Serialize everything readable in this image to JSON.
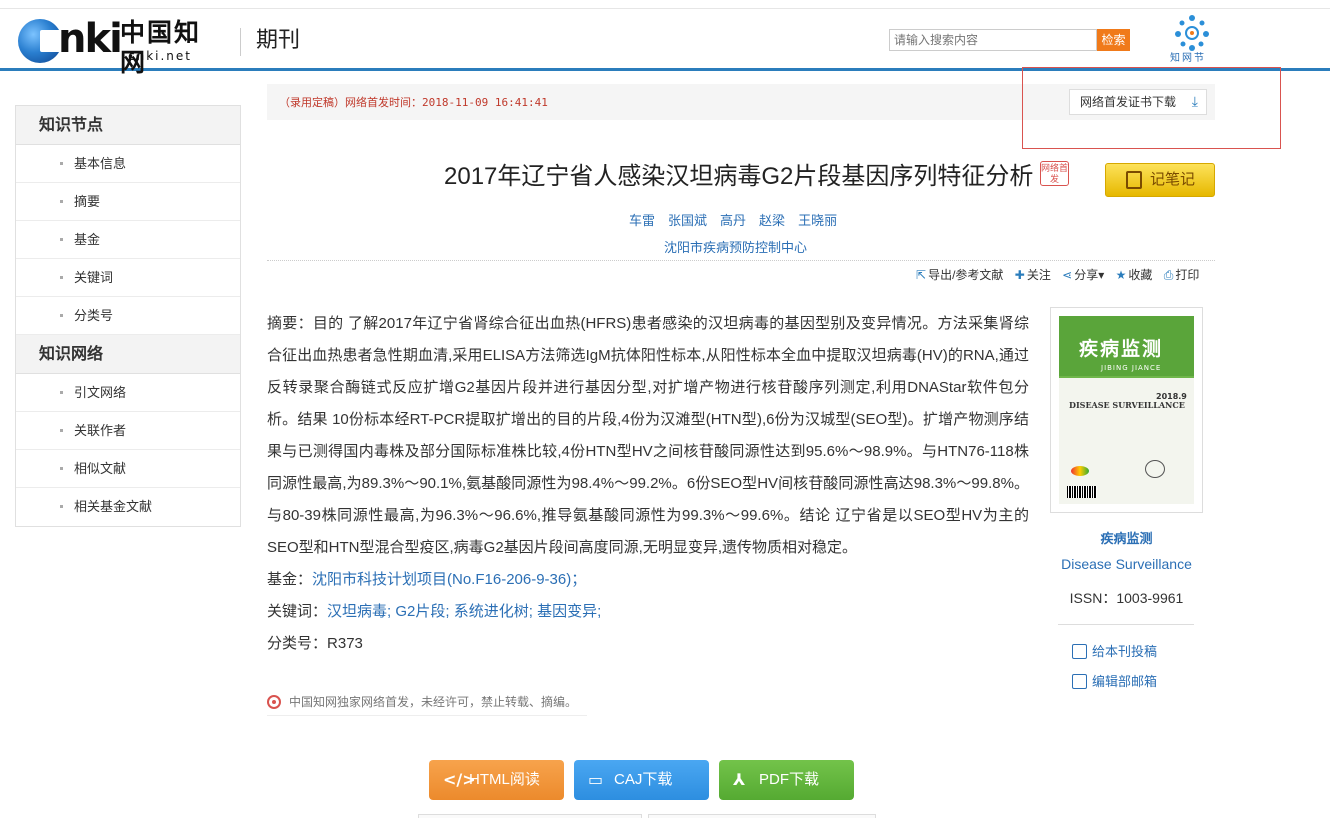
{
  "header": {
    "logo_cn": "中国知网",
    "logo_net": "cnki.net",
    "channel": "期刊",
    "search_placeholder": "请输入搜索内容",
    "search_button": "检索",
    "zwj_label": "知网节"
  },
  "sidebar": {
    "section1_title": "知识节点",
    "section1_items": [
      "基本信息",
      "摘要",
      "基金",
      "关键词",
      "分类号"
    ],
    "section2_title": "知识网络",
    "section2_items": [
      "引文网络",
      "关联作者",
      "相似文献",
      "相关基金文献"
    ]
  },
  "status": {
    "text": "（录用定稿）网络首发时间：2018-11-09 16:41:41",
    "cert_button": "网络首发证书下载"
  },
  "article": {
    "title": "2017年辽宁省人感染汉坦病毒G2片段基因序列特征分析",
    "net_first_badge": "网络首发",
    "note_button": "记笔记",
    "authors": [
      "车雷",
      "张国斌",
      "高丹",
      "赵梁",
      "王晓丽"
    ],
    "organization": "沈阳市疾病预防控制中心",
    "tools": {
      "export": "导出/参考文献",
      "follow": "关注",
      "share": "分享",
      "favorite": "收藏",
      "print": "打印"
    },
    "abstract": "摘要：目的 了解2017年辽宁省肾综合征出血热(HFRS)患者感染的汉坦病毒的基因型别及变异情况。方法采集肾综合征出血热患者急性期血清,采用ELISA方法筛选IgM抗体阳性标本,从阳性标本全血中提取汉坦病毒(HV)的RNA,通过反转录聚合酶链式反应扩增G2基因片段并进行基因分型,对扩增产物进行核苷酸序列测定,利用DNAStar软件包分析。结果 10份标本经RT-PCR提取扩增出的目的片段,4份为汉滩型(HTN型),6份为汉城型(SEO型)。扩增产物测序结果与已测得国内毒株及部分国际标准株比较,4份HTN型HV之间核苷酸同源性达到95.6%～98.9%。与HTN76-118株同源性最高,为89.3%～90.1%,氨基酸同源性为98.4%～99.2%。6份SEO型HV间核苷酸同源性高达98.3%～99.8%。与80-39株同源性最高,为96.3%～96.6%,推导氨基酸同源性为99.3%～99.6%。结论 辽宁省是以SEO型HV为主的SEO型和HTN型混合型疫区,病毒G2基因片段间高度同源,无明显变异,遗传物质相对稳定。",
    "fund_label": "基金：",
    "fund_value": "沈阳市科技计划项目(No.F16-206-9-36)；",
    "keywords_label": "关键词：",
    "keywords": [
      "汉坦病毒;",
      "G2片段;",
      "系统进化树;",
      "基因变异;"
    ],
    "class_label": "分类号：",
    "class_value": "R373",
    "copyright": "中国知网独家网络首发，未经许可，禁止转载、摘编。"
  },
  "journal": {
    "cover_cn": "疾病监测",
    "cover_pinyin": "JIBING JIANCE",
    "cover_en": "DISEASE SURVEILLANCE",
    "cover_issue": "2018.9",
    "name_cn": "疾病监测",
    "name_en": "Disease Surveillance",
    "issn": "ISSN：1003-9961",
    "submit_link": "给本刊投稿",
    "editor_mail": "编辑部邮箱"
  },
  "buttons": {
    "html_read": "HTML阅读",
    "caj_download": "CAJ下载",
    "pdf_download": "PDF下载"
  },
  "colors": {
    "accent_blue": "#2b7dbc",
    "link_blue": "#2b6fb5",
    "orange": "#f07a1a",
    "status_red": "#c0392b"
  }
}
